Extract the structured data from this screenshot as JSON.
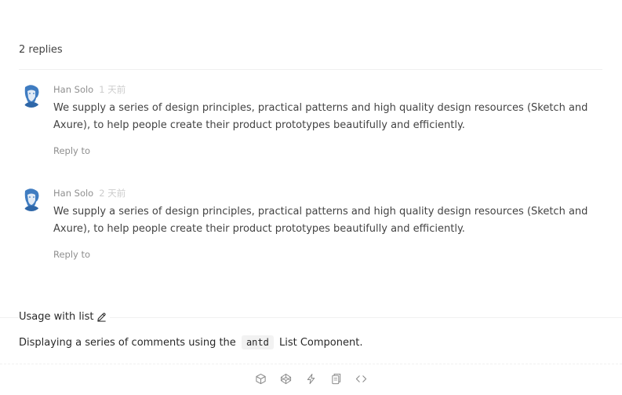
{
  "replies_header": "2 replies",
  "comments": [
    {
      "author": "Han Solo",
      "time": "1 天前",
      "content": "We supply a series of design principles, practical patterns and high quality design resources (Sketch and Axure), to help people create their product prototypes beautifully and efficiently.",
      "action": "Reply to"
    },
    {
      "author": "Han Solo",
      "time": "2 天前",
      "content": "We supply a series of design principles, practical patterns and high quality design resources (Sketch and Axure), to help people create their product prototypes beautifully and efficiently.",
      "action": "Reply to"
    }
  ],
  "section": {
    "title": "Usage with list",
    "desc_before": "Displaying a series of comments using the",
    "desc_code": "antd",
    "desc_after": "List Component."
  },
  "code_actions": [
    "codesandbox-icon",
    "codepen-icon",
    "stackblitz-icon",
    "copy-icon",
    "expand-code-icon"
  ],
  "colors": {
    "text_primary": "#262626",
    "text_secondary": "#8c8c8c",
    "time": "#cccccc",
    "divider": "#f0f0f0",
    "avatar_blue": "#3f7cc1"
  }
}
